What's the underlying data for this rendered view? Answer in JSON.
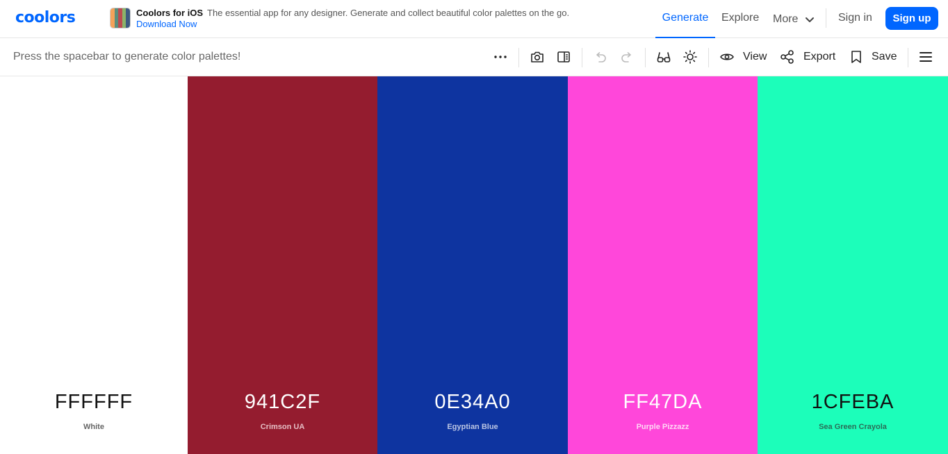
{
  "header": {
    "logo": "coolors",
    "promo": {
      "title": "Coolors for iOS",
      "description": "The essential app for any designer. Generate and collect beautiful color palettes on the go.",
      "link": "Download Now"
    },
    "nav": {
      "generate": "Generate",
      "explore": "Explore",
      "more": "More",
      "sign_in": "Sign in",
      "sign_up": "Sign up"
    },
    "accent_color": "#0066ff"
  },
  "toolbar": {
    "hint": "Press the spacebar to generate color palettes!",
    "view_label": "View",
    "export_label": "Export",
    "save_label": "Save",
    "icons": [
      "more-options-icon",
      "camera-icon",
      "panel-icon",
      "undo-icon",
      "redo-icon",
      "glasses-icon",
      "sun-icon",
      "eye-icon",
      "share-icon",
      "bookmark-icon",
      "menu-icon"
    ]
  },
  "palette": [
    {
      "hex": "FFFFFF",
      "name": "White",
      "color": "#FFFFFF",
      "text_color": "#111111",
      "name_color": "#666666"
    },
    {
      "hex": "941C2F",
      "name": "Crimson UA",
      "color": "#941C2F",
      "text_color": "#FFFFFF",
      "name_color": "#E6BFC5"
    },
    {
      "hex": "0E34A0",
      "name": "Egyptian Blue",
      "color": "#0E34A0",
      "text_color": "#FFFFFF",
      "name_color": "#BCC6E4"
    },
    {
      "hex": "FF47DA",
      "name": "Purple Pizzazz",
      "color": "#FF47DA",
      "text_color": "#FFFFFF",
      "name_color": "#FFD7F5"
    },
    {
      "hex": "1CFEBA",
      "name": "Sea Green Crayola",
      "color": "#1CFEBA",
      "text_color": "#111111",
      "name_color": "#2A6E58"
    }
  ]
}
